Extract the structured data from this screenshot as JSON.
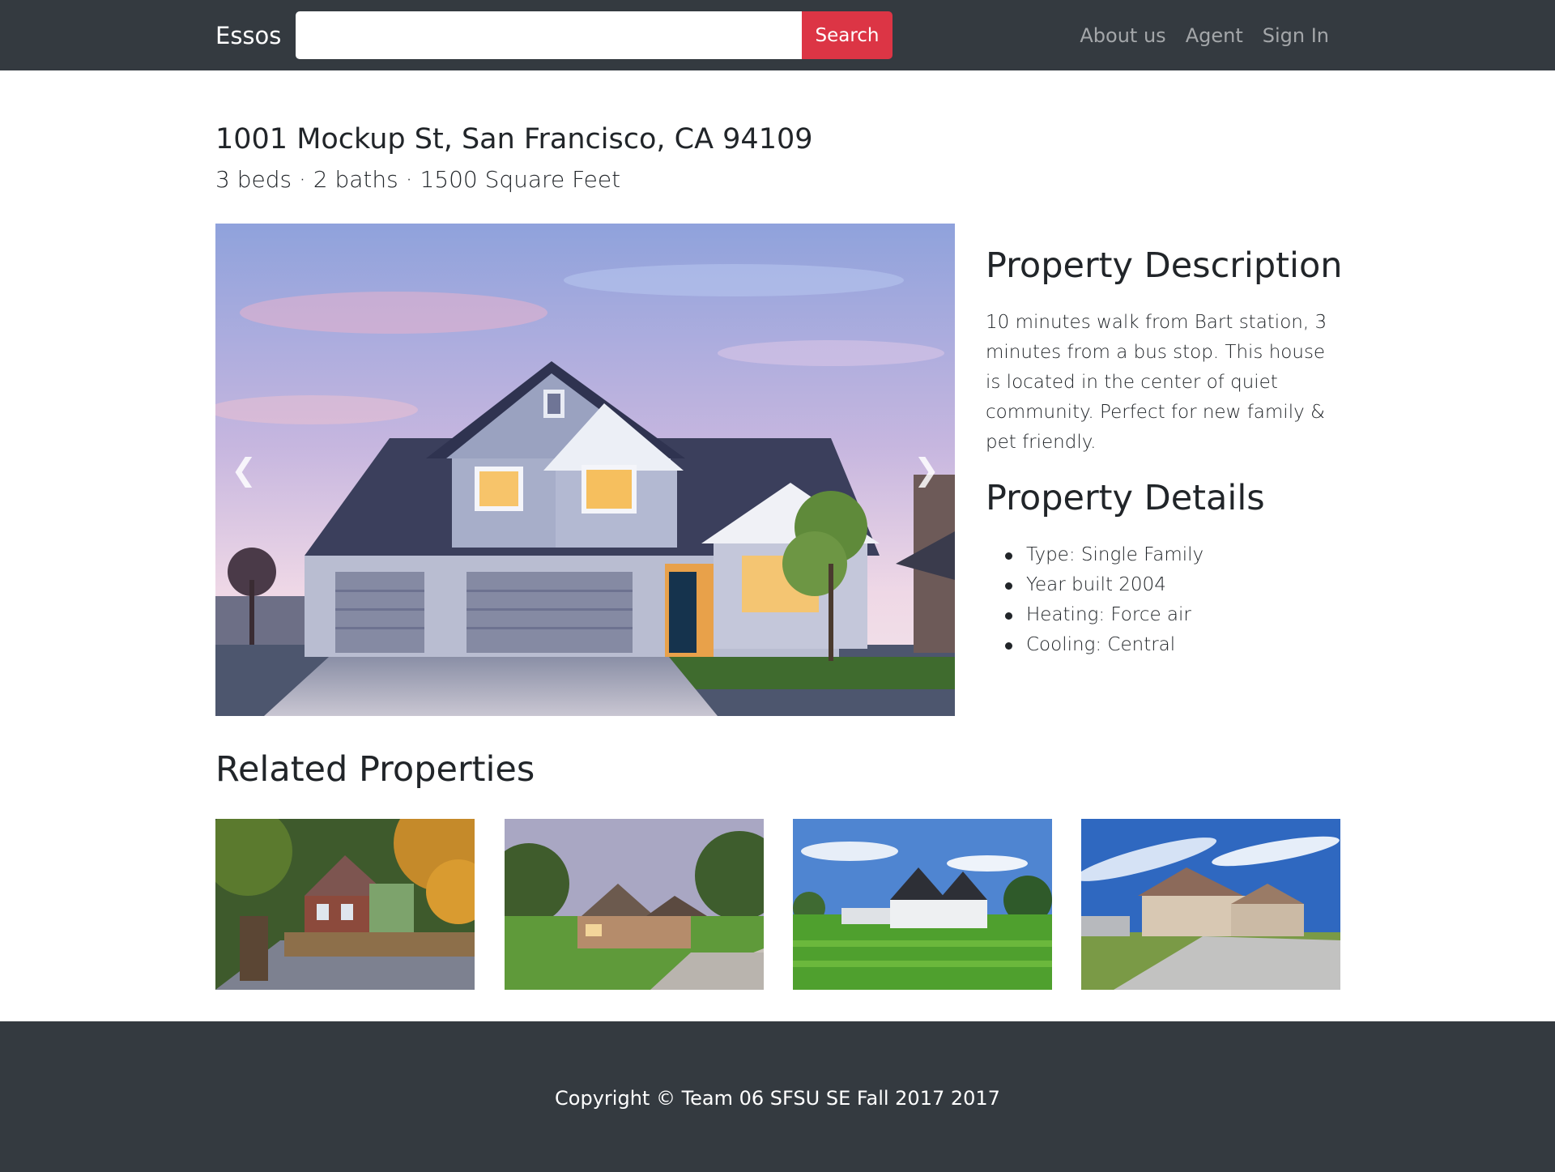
{
  "navbar": {
    "brand": "Essos",
    "search_placeholder": "",
    "search_value": "",
    "search_button": "Search",
    "links": [
      "About us",
      "Agent",
      "Sign In"
    ]
  },
  "listing": {
    "address": "1001 Mockup St, San Francisco, CA 94109",
    "summary": "3 beds · 2 baths · 1500 Square Feet"
  },
  "carousel": {
    "prev_icon": "chevron-left-icon",
    "next_icon": "chevron-right-icon"
  },
  "description": {
    "heading": "Property Description",
    "text": "10 minutes walk from Bart station, 3 minutes from a bus stop. This house is located in the center of quiet community. Perfect for new family & pet friendly."
  },
  "details": {
    "heading": "Property Details",
    "items": [
      "Type: Single Family",
      "Year built 2004",
      "Heating: Force air",
      "Cooling: Central"
    ]
  },
  "related": {
    "heading": "Related Properties"
  },
  "footer": {
    "copyright": "Copyright © Team 06 SFSU SE Fall 2017 2017"
  },
  "colors": {
    "navbar_bg": "#343a40",
    "search_button": "#dc3545",
    "text": "#212529"
  }
}
